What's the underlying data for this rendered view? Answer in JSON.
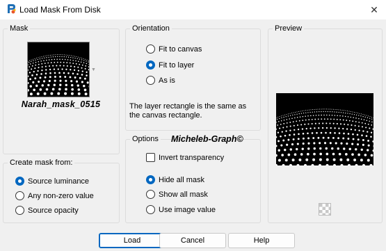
{
  "window": {
    "title": "Load Mask From Disk",
    "close_glyph": "✕"
  },
  "mask": {
    "group_label": "Mask",
    "name": "Narah_mask_0515"
  },
  "create_from": {
    "group_label": "Create mask from:",
    "options": [
      {
        "label": "Source luminance",
        "checked": true
      },
      {
        "label": "Any non-zero value",
        "checked": false
      },
      {
        "label": "Source opacity",
        "checked": false
      }
    ]
  },
  "orientation": {
    "group_label": "Orientation",
    "options": [
      {
        "label": "Fit to canvas",
        "checked": false
      },
      {
        "label": "Fit to layer",
        "checked": true
      },
      {
        "label": "As is",
        "checked": false
      }
    ],
    "description": "The layer rectangle is the same as the canvas rectangle."
  },
  "options": {
    "group_label": "Options",
    "signature": "Micheleb-Graph©",
    "invert_label": "Invert transparency",
    "invert_checked": false,
    "show_options": [
      {
        "label": "Hide all mask",
        "checked": true
      },
      {
        "label": "Show all mask",
        "checked": false
      },
      {
        "label": "Use image value",
        "checked": false
      }
    ]
  },
  "preview": {
    "group_label": "Preview"
  },
  "buttons": {
    "load": "Load",
    "cancel": "Cancel",
    "help": "Help"
  },
  "colors": {
    "accent": "#0067c0",
    "background": "#f0f0f0"
  }
}
